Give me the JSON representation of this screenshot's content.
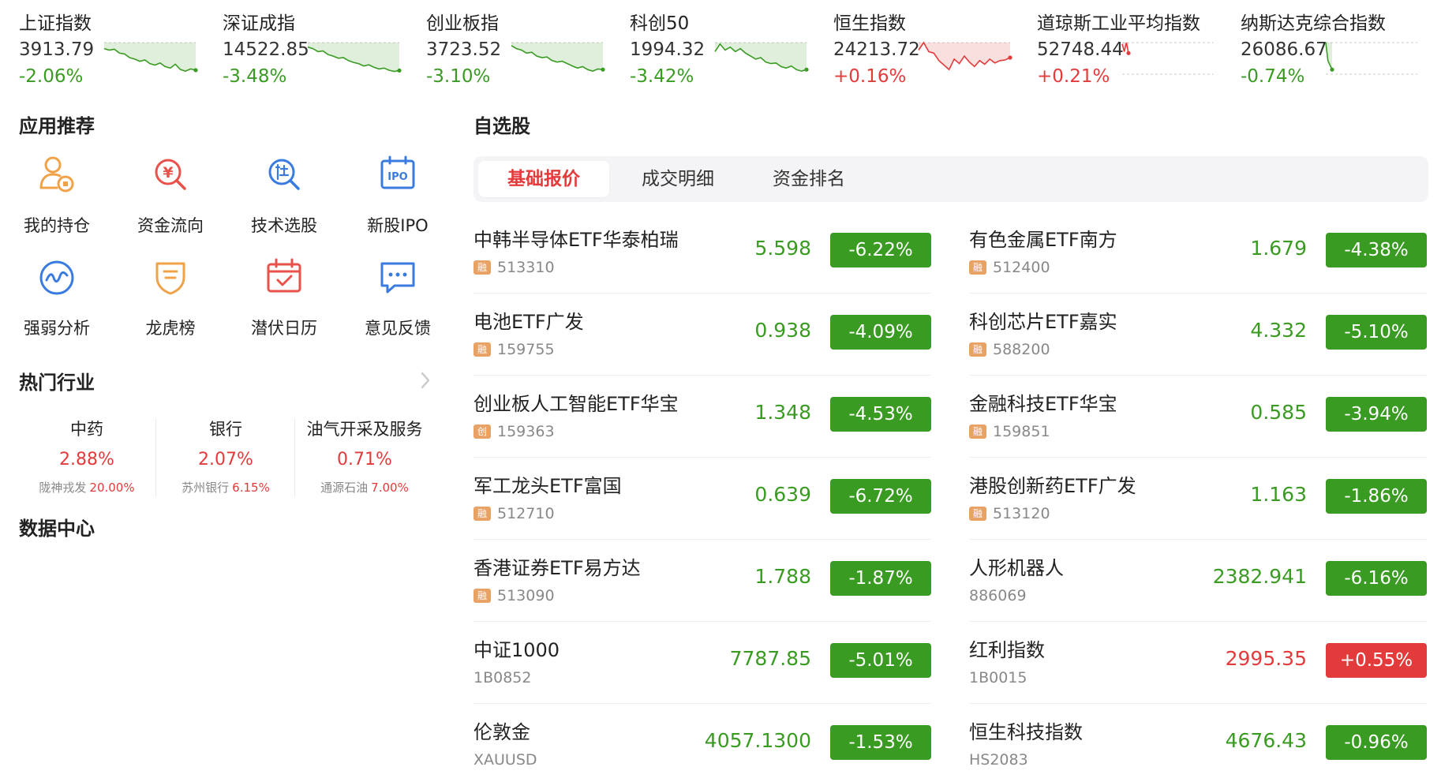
{
  "indices": [
    {
      "name": "上证指数",
      "value": "3913.79",
      "change": "-2.06%",
      "dir": "down",
      "color": "#3a9b22",
      "spark": [
        0.2,
        0.25,
        0.22,
        0.35,
        0.38,
        0.5,
        0.55,
        0.62,
        0.58,
        0.7,
        0.75,
        0.68,
        0.8,
        0.85,
        0.72,
        0.9,
        0.95,
        0.88,
        0.92
      ]
    },
    {
      "name": "深证成指",
      "value": "14522.85",
      "change": "-3.48%",
      "dir": "down",
      "color": "#3a9b22",
      "spark": [
        0.15,
        0.2,
        0.3,
        0.28,
        0.4,
        0.45,
        0.52,
        0.5,
        0.6,
        0.66,
        0.7,
        0.78,
        0.74,
        0.82,
        0.88,
        0.85,
        0.92,
        0.96,
        0.93
      ]
    },
    {
      "name": "创业板指",
      "value": "3723.52",
      "change": "-3.10%",
      "dir": "down",
      "color": "#3a9b22",
      "spark": [
        0.1,
        0.2,
        0.25,
        0.35,
        0.32,
        0.45,
        0.5,
        0.48,
        0.6,
        0.65,
        0.62,
        0.7,
        0.78,
        0.85,
        0.8,
        0.9,
        0.95,
        0.88,
        0.9
      ]
    },
    {
      "name": "科创50",
      "value": "1994.32",
      "change": "-3.42%",
      "dir": "down",
      "color": "#3a9b22",
      "spark": [
        0.3,
        0.05,
        0.25,
        0.15,
        0.3,
        0.2,
        0.35,
        0.45,
        0.55,
        0.5,
        0.65,
        0.7,
        0.68,
        0.8,
        0.85,
        0.78,
        0.9,
        0.95,
        0.9
      ]
    },
    {
      "name": "恒生指数",
      "value": "24213.72",
      "change": "+0.16%",
      "dir": "up",
      "color": "#e33b3b",
      "spark": [
        0.25,
        0.0,
        0.3,
        0.35,
        0.6,
        0.75,
        0.9,
        0.55,
        0.7,
        0.45,
        0.65,
        0.8,
        0.6,
        0.72,
        0.55,
        0.68,
        0.6,
        0.58,
        0.5
      ]
    },
    {
      "name": "道琼斯工业平均指数",
      "value": "52748.44",
      "change": "+0.21%",
      "dir": "up",
      "color": "#e33b3b",
      "spark": [
        0.05,
        0.3,
        0.0,
        0.35
      ]
    },
    {
      "name": "纳斯达克综合指数",
      "value": "26086.67",
      "change": "-0.74%",
      "dir": "down",
      "color": "#3a9b22",
      "spark": [
        0.0,
        0.6,
        0.75,
        0.9
      ]
    }
  ],
  "apps_title": "应用推荐",
  "apps": [
    {
      "label": "我的持仓",
      "icon": "holdings-icon"
    },
    {
      "label": "资金流向",
      "icon": "money-flow-icon"
    },
    {
      "label": "技术选股",
      "icon": "stock-picker-icon"
    },
    {
      "label": "新股IPO",
      "icon": "ipo-icon"
    },
    {
      "label": "强弱分析",
      "icon": "strength-analysis-icon"
    },
    {
      "label": "龙虎榜",
      "icon": "dragon-tiger-icon"
    },
    {
      "label": "潜伏日历",
      "icon": "calendar-icon"
    },
    {
      "label": "意见反馈",
      "icon": "feedback-icon"
    }
  ],
  "industry_title": "热门行业",
  "industries": [
    {
      "name": "中药",
      "pct": "2.88%",
      "leader": "陇神戎发",
      "leader_pct": "20.00%"
    },
    {
      "name": "银行",
      "pct": "2.07%",
      "leader": "苏州银行",
      "leader_pct": "6.15%"
    },
    {
      "name": "油气开采及服务",
      "pct": "0.71%",
      "leader": "通源石油",
      "leader_pct": "7.00%"
    }
  ],
  "data_center_title": "数据中心",
  "watchlist_title": "自选股",
  "tabs": [
    "基础报价",
    "成交明细",
    "资金排名"
  ],
  "stocks": [
    {
      "name": "中韩半导体ETF华泰柏瑞",
      "badge": "融",
      "code": "513310",
      "price": "5.598",
      "change": "-6.22%",
      "dir": "down"
    },
    {
      "name": "有色金属ETF南方",
      "badge": "融",
      "code": "512400",
      "price": "1.679",
      "change": "-4.38%",
      "dir": "down"
    },
    {
      "name": "电池ETF广发",
      "badge": "融",
      "code": "159755",
      "price": "0.938",
      "change": "-4.09%",
      "dir": "down"
    },
    {
      "name": "科创芯片ETF嘉实",
      "badge": "融",
      "code": "588200",
      "price": "4.332",
      "change": "-5.10%",
      "dir": "down"
    },
    {
      "name": "创业板人工智能ETF华宝",
      "badge": "创",
      "code": "159363",
      "price": "1.348",
      "change": "-4.53%",
      "dir": "down"
    },
    {
      "name": "金融科技ETF华宝",
      "badge": "融",
      "code": "159851",
      "price": "0.585",
      "change": "-3.94%",
      "dir": "down"
    },
    {
      "name": "军工龙头ETF富国",
      "badge": "融",
      "code": "512710",
      "price": "0.639",
      "change": "-6.72%",
      "dir": "down"
    },
    {
      "name": "港股创新药ETF广发",
      "badge": "融",
      "code": "513120",
      "price": "1.163",
      "change": "-1.86%",
      "dir": "down"
    },
    {
      "name": "香港证券ETF易方达",
      "badge": "融",
      "code": "513090",
      "price": "1.788",
      "change": "-1.87%",
      "dir": "down"
    },
    {
      "name": "人形机器人",
      "badge": "",
      "code": "886069",
      "price": "2382.941",
      "change": "-6.16%",
      "dir": "down"
    },
    {
      "name": "中证1000",
      "badge": "",
      "code": "1B0852",
      "price": "7787.85",
      "change": "-5.01%",
      "dir": "down"
    },
    {
      "name": "红利指数",
      "badge": "",
      "code": "1B0015",
      "price": "2995.35",
      "change": "+0.55%",
      "dir": "up"
    },
    {
      "name": "伦敦金",
      "badge": "",
      "code": "XAUUSD",
      "price": "4057.1300",
      "change": "-1.53%",
      "dir": "down"
    },
    {
      "name": "恒生科技指数",
      "badge": "",
      "code": "HS2083",
      "price": "4676.43",
      "change": "-0.96%",
      "dir": "down"
    }
  ],
  "colors": {
    "up": "#e33b3b",
    "down": "#3a9b22",
    "icon_orange": "#f0a248",
    "icon_red": "#e8524a",
    "icon_blue": "#3a7be0"
  }
}
